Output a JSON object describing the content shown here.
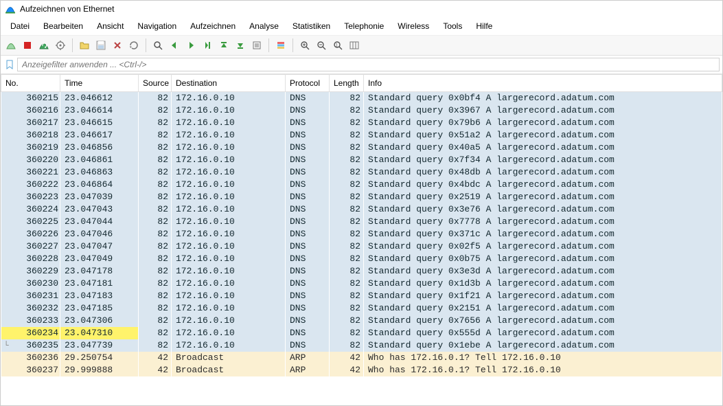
{
  "title": "Aufzeichnen von Ethernet",
  "menu": {
    "file": "Datei",
    "edit": "Bearbeiten",
    "view": "Ansicht",
    "go": "Navigation",
    "capture": "Aufzeichnen",
    "analyze": "Analyse",
    "statistics": "Statistiken",
    "telephony": "Telephonie",
    "wireless": "Wireless",
    "tools": "Tools",
    "help": "Hilfe"
  },
  "filter": {
    "placeholder": "Anzeigefilter anwenden ... <Ctrl-/>"
  },
  "columns": {
    "no": "No.",
    "time": "Time",
    "source": "Source",
    "destination": "Destination",
    "protocol": "Protocol",
    "length": "Length",
    "info": "Info"
  },
  "packets": [
    {
      "no": "360215",
      "time": "23.046612",
      "source": "82",
      "destination": "172.16.0.10",
      "protocol": "DNS",
      "length": "82",
      "info": "Standard query 0x0bf4 A largerecord.adatum.com",
      "class": "dns",
      "glyph": ""
    },
    {
      "no": "360216",
      "time": "23.046614",
      "source": "82",
      "destination": "172.16.0.10",
      "protocol": "DNS",
      "length": "82",
      "info": "Standard query 0x3967 A largerecord.adatum.com",
      "class": "dns",
      "glyph": ""
    },
    {
      "no": "360217",
      "time": "23.046615",
      "source": "82",
      "destination": "172.16.0.10",
      "protocol": "DNS",
      "length": "82",
      "info": "Standard query 0x79b6 A largerecord.adatum.com",
      "class": "dns",
      "glyph": ""
    },
    {
      "no": "360218",
      "time": "23.046617",
      "source": "82",
      "destination": "172.16.0.10",
      "protocol": "DNS",
      "length": "82",
      "info": "Standard query 0x51a2 A largerecord.adatum.com",
      "class": "dns",
      "glyph": ""
    },
    {
      "no": "360219",
      "time": "23.046856",
      "source": "82",
      "destination": "172.16.0.10",
      "protocol": "DNS",
      "length": "82",
      "info": "Standard query 0x40a5 A largerecord.adatum.com",
      "class": "dns",
      "glyph": ""
    },
    {
      "no": "360220",
      "time": "23.046861",
      "source": "82",
      "destination": "172.16.0.10",
      "protocol": "DNS",
      "length": "82",
      "info": "Standard query 0x7f34 A largerecord.adatum.com",
      "class": "dns",
      "glyph": ""
    },
    {
      "no": "360221",
      "time": "23.046863",
      "source": "82",
      "destination": "172.16.0.10",
      "protocol": "DNS",
      "length": "82",
      "info": "Standard query 0x48db A largerecord.adatum.com",
      "class": "dns",
      "glyph": ""
    },
    {
      "no": "360222",
      "time": "23.046864",
      "source": "82",
      "destination": "172.16.0.10",
      "protocol": "DNS",
      "length": "82",
      "info": "Standard query 0x4bdc A largerecord.adatum.com",
      "class": "dns",
      "glyph": ""
    },
    {
      "no": "360223",
      "time": "23.047039",
      "source": "82",
      "destination": "172.16.0.10",
      "protocol": "DNS",
      "length": "82",
      "info": "Standard query 0x2519 A largerecord.adatum.com",
      "class": "dns",
      "glyph": ""
    },
    {
      "no": "360224",
      "time": "23.047043",
      "source": "82",
      "destination": "172.16.0.10",
      "protocol": "DNS",
      "length": "82",
      "info": "Standard query 0x3e76 A largerecord.adatum.com",
      "class": "dns",
      "glyph": ""
    },
    {
      "no": "360225",
      "time": "23.047044",
      "source": "82",
      "destination": "172.16.0.10",
      "protocol": "DNS",
      "length": "82",
      "info": "Standard query 0x7778 A largerecord.adatum.com",
      "class": "dns",
      "glyph": ""
    },
    {
      "no": "360226",
      "time": "23.047046",
      "source": "82",
      "destination": "172.16.0.10",
      "protocol": "DNS",
      "length": "82",
      "info": "Standard query 0x371c A largerecord.adatum.com",
      "class": "dns",
      "glyph": ""
    },
    {
      "no": "360227",
      "time": "23.047047",
      "source": "82",
      "destination": "172.16.0.10",
      "protocol": "DNS",
      "length": "82",
      "info": "Standard query 0x02f5 A largerecord.adatum.com",
      "class": "dns",
      "glyph": ""
    },
    {
      "no": "360228",
      "time": "23.047049",
      "source": "82",
      "destination": "172.16.0.10",
      "protocol": "DNS",
      "length": "82",
      "info": "Standard query 0x0b75 A largerecord.adatum.com",
      "class": "dns",
      "glyph": ""
    },
    {
      "no": "360229",
      "time": "23.047178",
      "source": "82",
      "destination": "172.16.0.10",
      "protocol": "DNS",
      "length": "82",
      "info": "Standard query 0x3e3d A largerecord.adatum.com",
      "class": "dns",
      "glyph": ""
    },
    {
      "no": "360230",
      "time": "23.047181",
      "source": "82",
      "destination": "172.16.0.10",
      "protocol": "DNS",
      "length": "82",
      "info": "Standard query 0x1d3b A largerecord.adatum.com",
      "class": "dns",
      "glyph": ""
    },
    {
      "no": "360231",
      "time": "23.047183",
      "source": "82",
      "destination": "172.16.0.10",
      "protocol": "DNS",
      "length": "82",
      "info": "Standard query 0x1f21 A largerecord.adatum.com",
      "class": "dns",
      "glyph": ""
    },
    {
      "no": "360232",
      "time": "23.047185",
      "source": "82",
      "destination": "172.16.0.10",
      "protocol": "DNS",
      "length": "82",
      "info": "Standard query 0x2151 A largerecord.adatum.com",
      "class": "dns",
      "glyph": ""
    },
    {
      "no": "360233",
      "time": "23.047306",
      "source": "82",
      "destination": "172.16.0.10",
      "protocol": "DNS",
      "length": "82",
      "info": "Standard query 0x7656 A largerecord.adatum.com",
      "class": "dns",
      "glyph": ""
    },
    {
      "no": "360234",
      "time": "23.047310",
      "source": "82",
      "destination": "172.16.0.10",
      "protocol": "DNS",
      "length": "82",
      "info": "Standard query 0x555d A largerecord.adatum.com",
      "class": "dns highlight",
      "glyph": ""
    },
    {
      "no": "360235",
      "time": "23.047739",
      "source": "82",
      "destination": "172.16.0.10",
      "protocol": "DNS",
      "length": "82",
      "info": "Standard query 0x1ebe A largerecord.adatum.com",
      "class": "dns",
      "glyph": "└"
    },
    {
      "no": "360236",
      "time": "29.250754",
      "source": "42",
      "destination": "Broadcast",
      "protocol": "ARP",
      "length": "42",
      "info": "Who has 172.16.0.1? Tell 172.16.0.10",
      "class": "arp",
      "glyph": ""
    },
    {
      "no": "360237",
      "time": "29.999888",
      "source": "42",
      "destination": "Broadcast",
      "protocol": "ARP",
      "length": "42",
      "info": "Who has 172.16.0.1? Tell 172.16.0.10",
      "class": "arp",
      "glyph": ""
    }
  ]
}
